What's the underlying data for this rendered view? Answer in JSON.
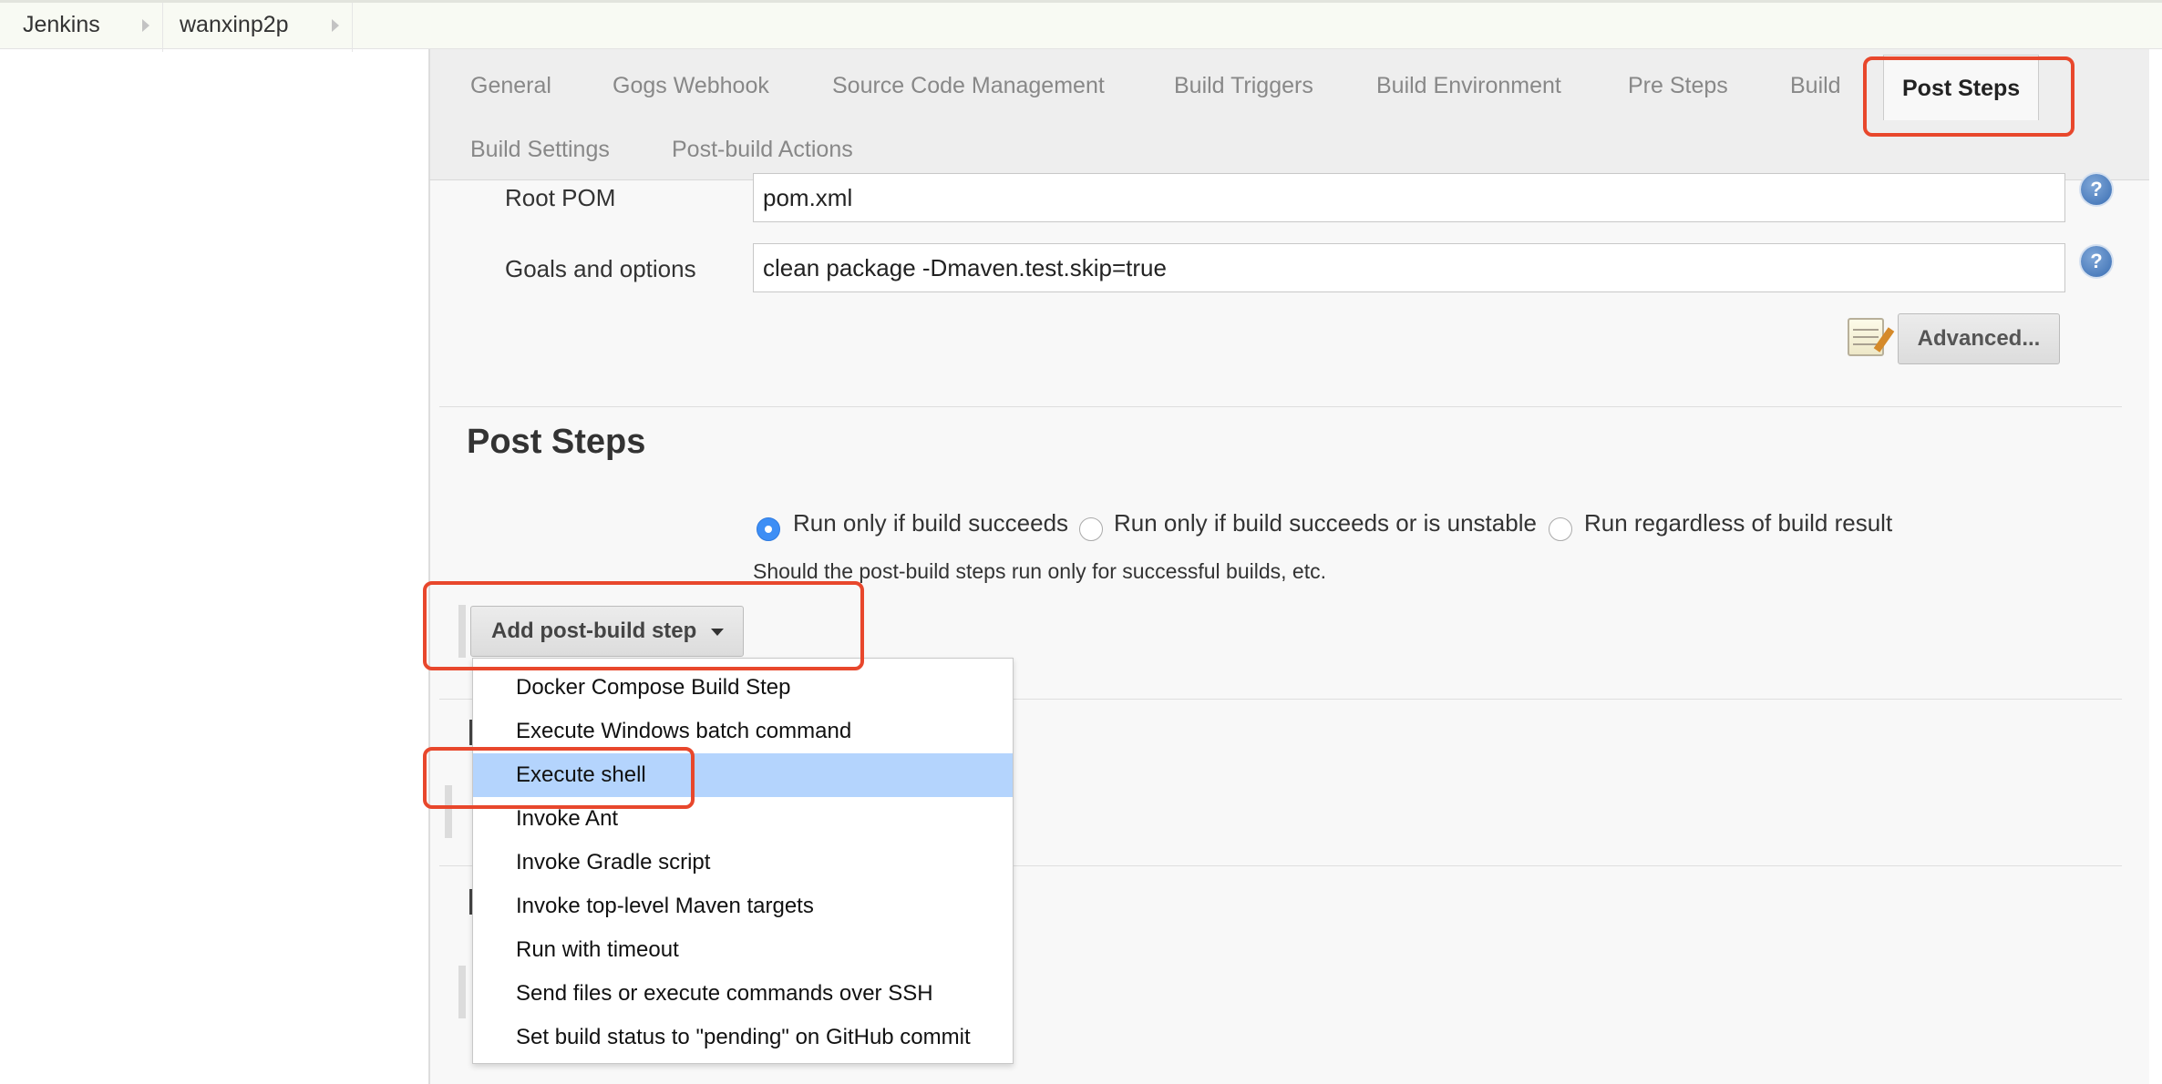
{
  "breadcrumb": {
    "items": [
      "Jenkins",
      "wanxinp2p"
    ]
  },
  "tabs": [
    "General",
    "Gogs Webhook",
    "Source Code Management",
    "Build Triggers",
    "Build Environment",
    "Pre Steps",
    "Build",
    "Post Steps",
    "Build Settings",
    "Post-build Actions"
  ],
  "active_tab": "Post Steps",
  "form": {
    "root_pom": {
      "label": "Root POM",
      "value": "pom.xml"
    },
    "goals": {
      "label": "Goals and options",
      "value": "clean package -Dmaven.test.skip=true"
    },
    "advanced_label": "Advanced...",
    "help_glyph": "?"
  },
  "post_steps": {
    "title": "Post Steps",
    "radios": [
      {
        "label": "Run only if build succeeds",
        "checked": true
      },
      {
        "label": "Run only if build succeeds or is unstable",
        "checked": false
      },
      {
        "label": "Run regardless of build result",
        "checked": false
      }
    ],
    "hint": "Should the post-build steps run only for successful builds, etc.",
    "add_step_label": "Add post-build step",
    "menu_items": [
      "Docker Compose Build Step",
      "Execute Windows batch command",
      "Execute shell",
      "Invoke Ant",
      "Invoke Gradle script",
      "Invoke top-level Maven targets",
      "Run with timeout",
      "Send files or execute commands over SSH",
      "Set build status to \"pending\" on GitHub commit"
    ],
    "highlighted_item": "Execute shell"
  },
  "colors": {
    "annotation": "#e8472c",
    "highlight": "#b4d4fd",
    "radio_checked": "#3d8ef5"
  },
  "icons": [
    "help-icon",
    "notepad-icon",
    "chevron-down-icon",
    "breadcrumb-arrow-icon"
  ]
}
